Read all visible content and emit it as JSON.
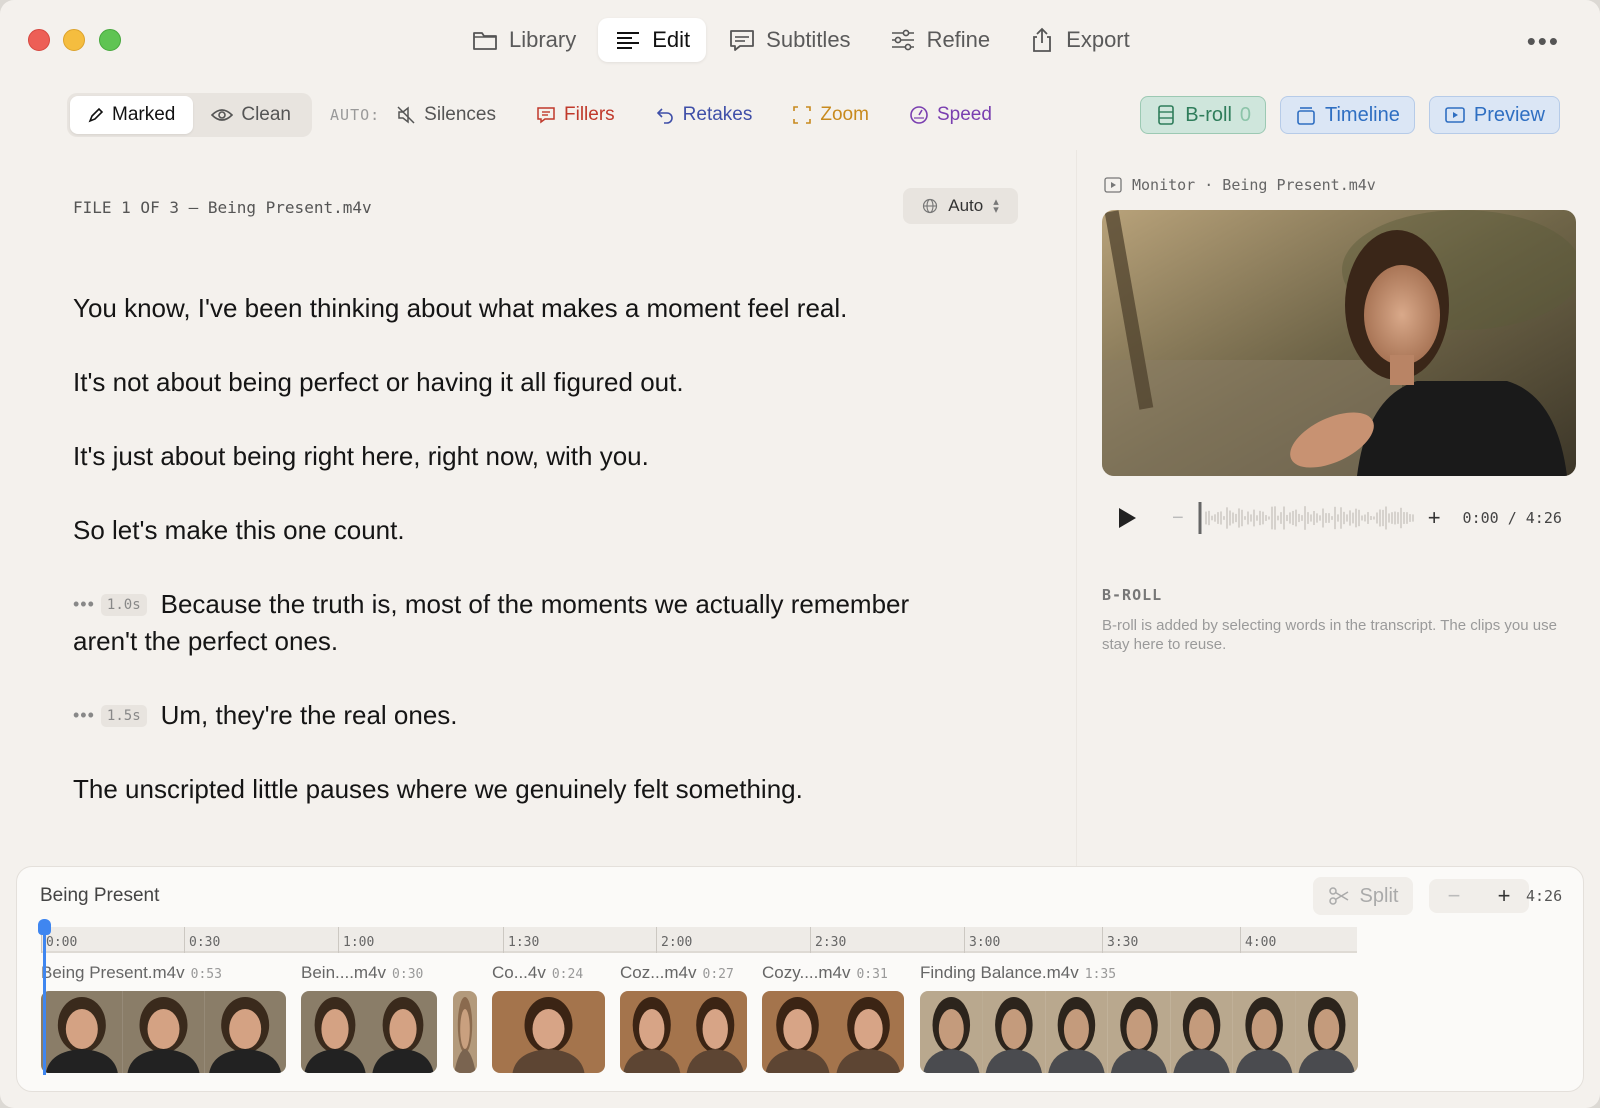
{
  "nav": [
    {
      "label": "Library",
      "icon": "folder-icon",
      "active": false
    },
    {
      "label": "Edit",
      "icon": "lines-icon",
      "active": true
    },
    {
      "label": "Subtitles",
      "icon": "speech-bubble-icon",
      "active": false
    },
    {
      "label": "Refine",
      "icon": "sliders-icon",
      "active": false
    },
    {
      "label": "Export",
      "icon": "share-icon",
      "active": false
    }
  ],
  "toolbar": {
    "marked_label": "Marked",
    "clean_label": "Clean",
    "auto_label": "AUTO:",
    "silences_label": "Silences",
    "fillers_label": "Fillers",
    "retakes_label": "Retakes",
    "zoom_label": "Zoom",
    "speed_label": "Speed"
  },
  "right_tools": {
    "broll_label": "B-roll",
    "broll_count": "0",
    "timeline_label": "Timeline",
    "preview_label": "Preview"
  },
  "transcript": {
    "file_header": "FILE 1 OF 3 — Being Present.m4v",
    "language": "Auto",
    "paragraphs": [
      {
        "pause": "",
        "text": "You know, I've been thinking about what makes a moment feel real."
      },
      {
        "pause": "",
        "text": "It's not about being perfect or having it all figured out."
      },
      {
        "pause": "",
        "text": "It's just about being right here, right now, with you."
      },
      {
        "pause": "",
        "text": "So let's make this one count."
      },
      {
        "pause": "1.0s",
        "text": "Because the truth is, most of the moments we actually remember aren't the perfect ones."
      },
      {
        "pause": "1.5s",
        "text": "Um, they're the real ones."
      },
      {
        "pause": "",
        "text": "The unscripted little pauses where we genuinely felt something."
      }
    ]
  },
  "monitor": {
    "label": "Monitor · Being Present.m4v",
    "timecode": "0:00 / 4:26"
  },
  "broll": {
    "title": "B-ROLL",
    "description": "B-roll is added by selecting words in the transcript. The clips you use stay here to reuse."
  },
  "timeline": {
    "title": "Being Present",
    "split_label": "Split",
    "duration": "4:26",
    "ticks": [
      "0:00",
      "0:30",
      "1:00",
      "1:30",
      "2:00",
      "2:30",
      "3:00",
      "3:30",
      "4:00"
    ],
    "clips": [
      {
        "name": "Being Present.m4v",
        "duration": "0:53"
      },
      {
        "name": "Bein....m4v",
        "duration": "0:30"
      },
      {
        "name": "Co...4v",
        "duration": "0:24"
      },
      {
        "name": "Coz...m4v",
        "duration": "0:27"
      },
      {
        "name": "Cozy....m4v",
        "duration": "0:31"
      },
      {
        "name": "Finding Balance.m4v",
        "duration": "1:35"
      }
    ]
  },
  "colors": {
    "accent_blue": "#3f86f0",
    "fillers": "#c0392b",
    "retakes": "#3f4fa8",
    "zoom": "#c88a1e",
    "speed": "#7a3fb0",
    "broll_green": "#2f7d5b"
  }
}
